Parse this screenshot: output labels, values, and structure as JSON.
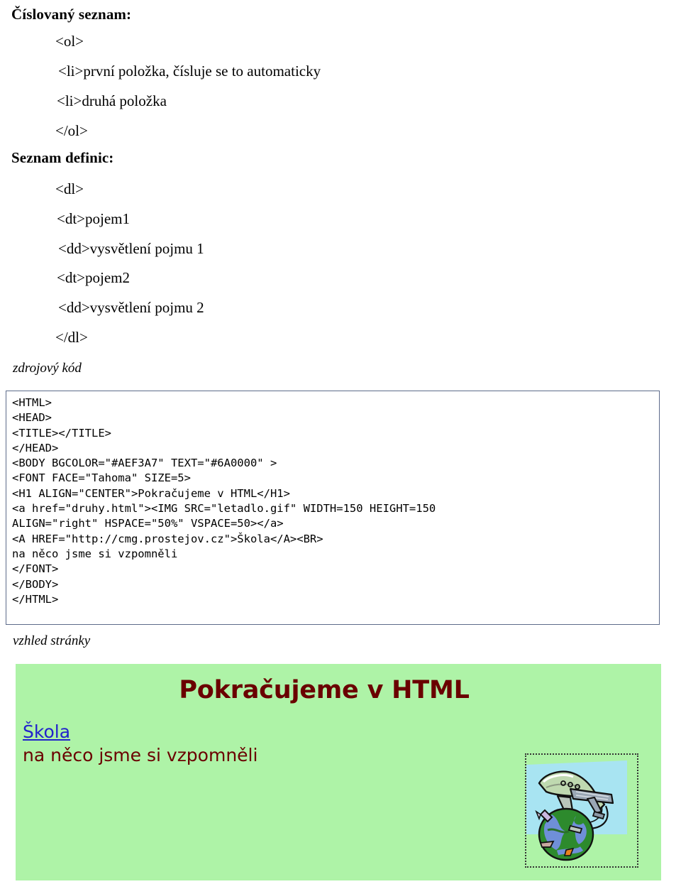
{
  "sections": {
    "ordered_list": {
      "title": "Číslovaný seznam:",
      "lines": [
        "<ol>",
        "<li>první položka, čísluje se to automaticky",
        "<li>druhá položka",
        "</ol>"
      ]
    },
    "definition_list": {
      "title": "Seznam definic:",
      "lines": [
        "<dl>",
        "<dt>pojem1",
        "<dd>vysvětlení pojmu 1",
        "<dt>pojem2",
        "<dd>vysvětlení pojmu 2",
        "</dl>"
      ]
    }
  },
  "source_code": {
    "caption": "zdrojový kód",
    "text": "<HTML>\n<HEAD>\n<TITLE></TITLE>\n</HEAD>\n<BODY BGCOLOR=\"#AEF3A7\" TEXT=\"#6A0000\" >\n<FONT FACE=\"Tahoma\" SIZE=5>\n<H1 ALIGN=\"CENTER\">Pokračujeme v HTML</H1>\n<a href=\"druhy.html\"><IMG SRC=\"letadlo.gif\" WIDTH=150 HEIGHT=150\nALIGN=\"right\" HSPACE=\"50%\" VSPACE=50></a>\n<A HREF=\"http://cmg.prostejov.cz\">Škola</A><BR>\nna něco jsme si vzpomněli\n</FONT>\n</BODY>\n</HTML>"
  },
  "preview": {
    "caption": "vzhled stránky",
    "heading": "Pokračujeme v HTML",
    "link_text": "Škola",
    "body_text": "na něco jsme si vzpomněli",
    "background_color": "#AEF3A7",
    "text_color": "#6A0000",
    "link_color": "#2222CC",
    "image_alt": "letadlo.gif"
  }
}
